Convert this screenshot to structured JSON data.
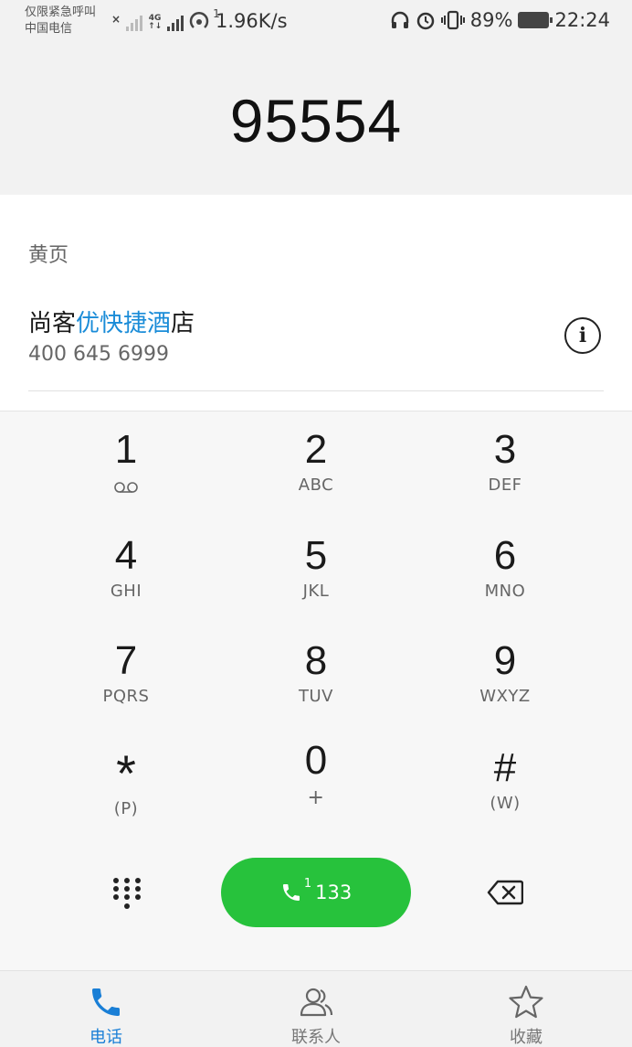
{
  "status_bar": {
    "carrier_line1": "仅限紧急呼叫",
    "carrier_line2": "中国电信",
    "net_tag_top": "4G",
    "net_tag_bottom": "↑↓",
    "hotspot_count": "1",
    "speed": "1.96K/s",
    "battery": "89%",
    "time": "22:24"
  },
  "dialer": {
    "number": "95554"
  },
  "suggestions": {
    "section_label": "黄页",
    "contact": {
      "name_prefix": "尚客",
      "name_highlight": "优快捷酒",
      "name_suffix": "店",
      "phone": "400 645 6999"
    },
    "info_label": "i"
  },
  "keypad": {
    "keys": [
      {
        "digit": "1",
        "letters": ""
      },
      {
        "digit": "2",
        "letters": "ABC"
      },
      {
        "digit": "3",
        "letters": "DEF"
      },
      {
        "digit": "4",
        "letters": "GHI"
      },
      {
        "digit": "5",
        "letters": "JKL"
      },
      {
        "digit": "6",
        "letters": "MNO"
      },
      {
        "digit": "7",
        "letters": "PQRS"
      },
      {
        "digit": "8",
        "letters": "TUV"
      },
      {
        "digit": "9",
        "letters": "WXYZ"
      },
      {
        "digit": "*",
        "letters": "(P)"
      },
      {
        "digit": "0",
        "letters": "+"
      },
      {
        "digit": "#",
        "letters": "(W)"
      }
    ],
    "call_button": {
      "sim": "1",
      "label": "133"
    }
  },
  "bottom_nav": {
    "items": [
      {
        "label": "电话",
        "icon": "phone-icon",
        "active": true
      },
      {
        "label": "联系人",
        "icon": "contacts-icon",
        "active": false
      },
      {
        "label": "收藏",
        "icon": "star-icon",
        "active": false
      }
    ]
  },
  "colors": {
    "call_green": "#27c23c",
    "highlight_blue": "#1a8cd8",
    "active_tab": "#1a7fd6"
  }
}
